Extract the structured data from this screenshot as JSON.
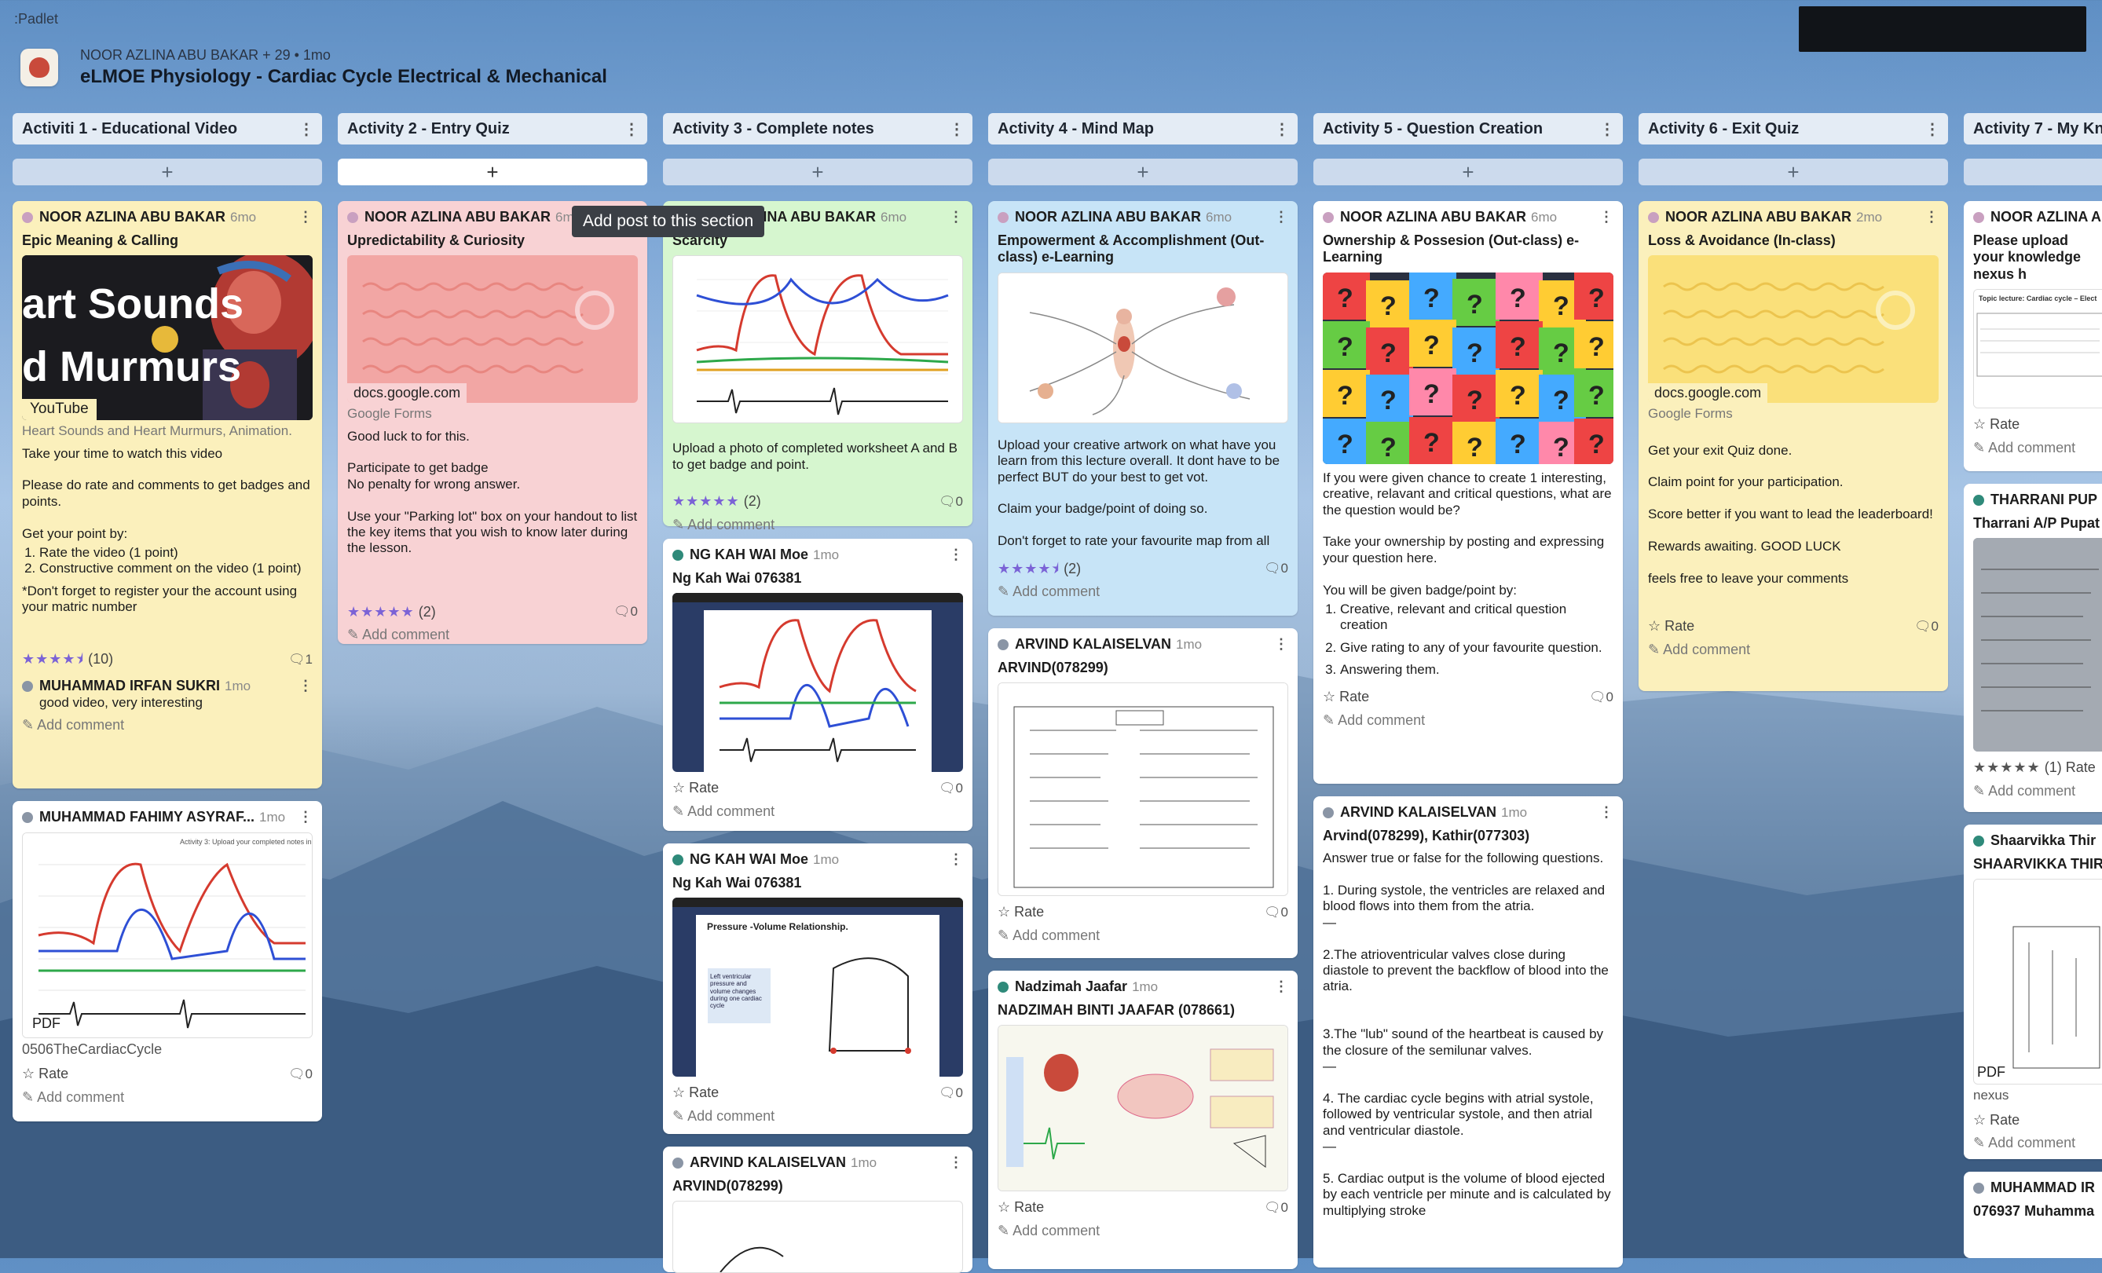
{
  "brand": ":Padlet",
  "header": {
    "meta": "NOOR AZLINA ABU BAKAR + 29 •  1mo",
    "title": "eLMOE Physiology - Cardiac Cycle Electrical & Mechanical"
  },
  "tooltip": "Add post to this section",
  "columns": [
    {
      "title": "Activiti 1 - Educational Video"
    },
    {
      "title": "Activity 2 -  Entry Quiz"
    },
    {
      "title": "Activity 3 - Complete notes"
    },
    {
      "title": "Activity 4 - Mind Map"
    },
    {
      "title": "Activity 5 - Question Creation"
    },
    {
      "title": "Activity 6 - Exit Quiz"
    },
    {
      "title": "Activity 7 - My Kn"
    }
  ],
  "cards": {
    "c1a": {
      "author": "NOOR AZLINA ABU BAKAR",
      "time": "6mo",
      "title": "Epic Meaning & Calling",
      "video_text1": "art Sounds",
      "video_text2": "d Murmurs",
      "video_source": "YouTube",
      "media_sub": "Heart Sounds and Heart Murmurs, Animation.",
      "body1": "Take your time to watch this video\n\nPlease do rate and comments to get badges and points.\n\nGet your point by:",
      "li1": "Rate the video (1 point)",
      "li2": "Constructive comment on the video (1 point)",
      "body2": "*Don't forget to register your the account using your matric number",
      "stars": "★★★★⯨",
      "rating": "(10)",
      "comments": "1",
      "reply_author": "MUHAMMAD IRFAN SUKRI",
      "reply_time": "1mo",
      "reply_text": "good video, very interesting",
      "add_comment": "Add comment"
    },
    "c1b": {
      "author": "MUHAMMAD FAHIMY ASYRAF...",
      "time": "1mo",
      "pdf": "PDF",
      "file": "0506TheCardiacCycle",
      "rate": "Rate",
      "comments": "0",
      "add_comment": "Add comment"
    },
    "c2a": {
      "author": "NOOR AZLINA ABU BAKAR",
      "time": "6mo",
      "title": "Upredictability & Curiosity",
      "link": "docs.google.com",
      "link_sub": "Google Forms",
      "body": "Good luck to for this.\n\nParticipate to get badge\nNo penalty for wrong answer.\n\nUse your \"Parking lot\" box on your handout to list the key items that you wish to know later during the lesson.",
      "stars": "★★★★★",
      "rating": "(2)",
      "comments": "0",
      "add_comment": "Add comment"
    },
    "c3a": {
      "author": "NOOR AZLINA ABU BAKAR",
      "time": "6mo",
      "title": "Scarcity",
      "body": "Upload a photo of completed worksheet A and B to get badge and point.",
      "stars": "★★★★★",
      "rating": "(2)",
      "comments": "0",
      "add_comment": "Add comment"
    },
    "c3b": {
      "author": "NG KAH WAI Moe",
      "time": "1mo",
      "title": "Ng Kah Wai 076381",
      "rate": "Rate",
      "comments": "0",
      "add_comment": "Add comment"
    },
    "c3c": {
      "author": "NG KAH WAI Moe",
      "time": "1mo",
      "title": "Ng Kah Wai 076381",
      "thumb_heading": "Pressure -Volume Relationship.",
      "thumb_note": "Left ventricular pressure and volume changes during one cardiac cycle",
      "rate": "Rate",
      "comments": "0",
      "add_comment": "Add comment"
    },
    "c3d": {
      "author": "ARVIND KALAISELVAN",
      "time": "1mo",
      "title": "ARVIND(078299)"
    },
    "c4a": {
      "author": "NOOR AZLINA ABU BAKAR",
      "time": "6mo",
      "title": "Empowerment & Accomplishment (Out-class) e-Learning",
      "body": "Upload your creative artwork on what have you learn from this lecture overall. It dont have to be perfect BUT do your best to get vot.\n\nClaim your badge/point of doing so.\n\nDon't forget to rate your favourite map from all",
      "stars": "★★★★⯨",
      "rating": "(2)",
      "comments": "0",
      "add_comment": "Add comment"
    },
    "c4b": {
      "author": "ARVIND KALAISELVAN",
      "time": "1mo",
      "title": "ARVIND(078299)",
      "rate": "Rate",
      "comments": "0",
      "add_comment": "Add comment"
    },
    "c4c": {
      "author": "Nadzimah Jaafar",
      "time": "1mo",
      "title": "NADZIMAH BINTI JAAFAR (078661)",
      "rate": "Rate",
      "comments": "0",
      "add_comment": "Add comment"
    },
    "c5a": {
      "author": "NOOR AZLINA ABU BAKAR",
      "time": "6mo",
      "title": "Ownership & Possesion (Out-class) e-Learning",
      "body1": "If you were given chance to create 1 interesting, creative, relavant and critical questions, what are the question would be?\n\nTake your ownership by posting and expressing your question here.\n\nYou will be given badge/point by:",
      "li1": "Creative, relevant and critical question creation",
      "li2": "Give rating to any of your favourite question.",
      "li3": "Answering them.",
      "rate": "Rate",
      "comments": "0",
      "add_comment": "Add comment"
    },
    "c5b": {
      "author": "ARVIND KALAISELVAN",
      "time": "1mo",
      "title": "Arvind(078299), Kathir(077303)",
      "body": "Answer true or false for the following questions.\n\n1.  During systole, the ventricles are relaxed and blood flows into them from the atria.\n—\n\n2.The atrioventricular valves close during diastole to prevent the backflow of blood into the atria.\n\n\n3.The \"lub\" sound of the heartbeat is caused by the closure of the semilunar valves.\n—\n\n4.  The cardiac cycle begins with atrial systole, followed by ventricular systole, and then atrial and ventricular diastole.\n—\n\n5.  Cardiac output is the volume of blood ejected by each ventricle per minute and is calculated by multiplying stroke"
    },
    "c6a": {
      "author": "NOOR AZLINA ABU BAKAR",
      "time": "2mo",
      "title": "Loss & Avoidance (In-class)",
      "link": "docs.google.com",
      "link_sub": "Google Forms",
      "body": "Get your exit Quiz done.\n\nClaim point for your participation.\n\nScore better if you want to lead the leaderboard!\n\nRewards awaiting. GOOD LUCK\n\nfeels free to leave your comments",
      "rate": "Rate",
      "comments": "0",
      "add_comment": "Add comment"
    },
    "c7a": {
      "author": "NOOR AZLINA A",
      "title": "Please upload your knowledge nexus h",
      "thumb_heading": "Topic lecture: Cardiac cycle – Elect",
      "rate": "Rate",
      "add_comment": "Add comment"
    },
    "c7b": {
      "author": "THARRANI PUP",
      "title": "Tharrani A/P Pupat",
      "stars": "★★★★★",
      "rating": "(1) Rate",
      "add_comment": "Add comment"
    },
    "c7c": {
      "author": "Shaarvikka Thir",
      "title": "SHAARVIKKA THIR",
      "pdf": "PDF",
      "file": "nexus",
      "rate": "Rate",
      "add_comment": "Add comment"
    },
    "c7d": {
      "author": "MUHAMMAD IR",
      "title": "076937 Muhamma"
    }
  },
  "chart_data": {
    "type": "line",
    "title": "",
    "xlabel": "",
    "ylabel": "",
    "series": []
  }
}
